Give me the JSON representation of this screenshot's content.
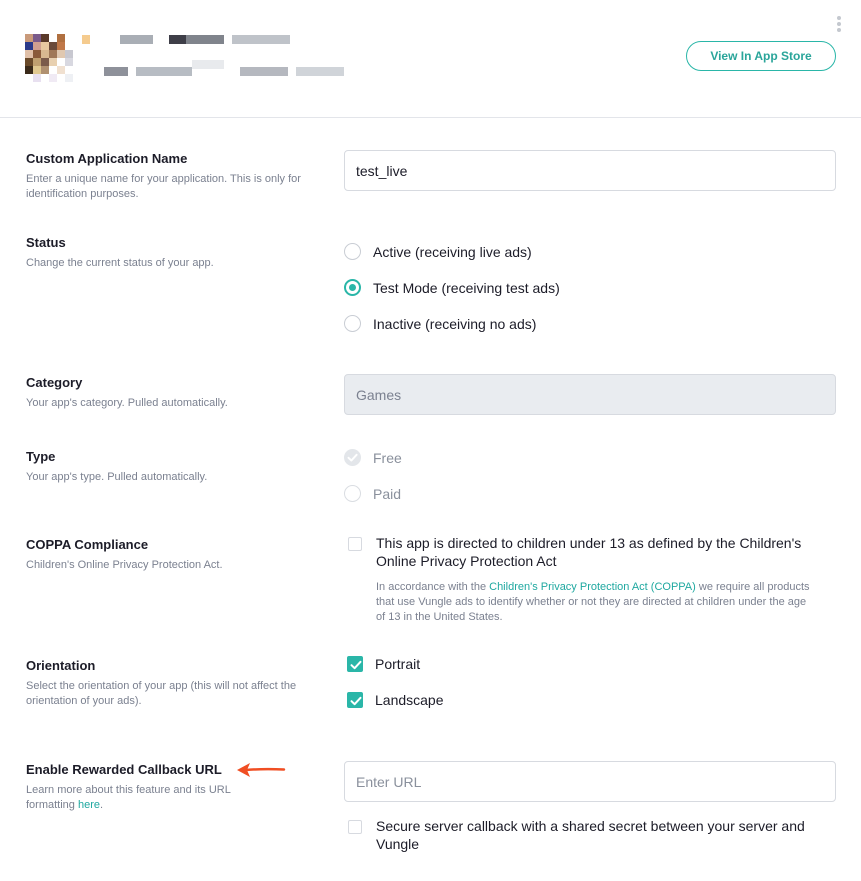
{
  "header": {
    "view_store_button": "View In App Store"
  },
  "fields": {
    "name": {
      "label": "Custom Application Name",
      "desc": "Enter a unique name for your application. This is only for identification purposes.",
      "value": "test_live"
    },
    "status": {
      "label": "Status",
      "desc": "Change the current status of your app.",
      "options": [
        "Active (receiving live ads)",
        "Test Mode (receiving test ads)",
        "Inactive (receiving no ads)"
      ],
      "selected": "Test Mode (receiving test ads)"
    },
    "category": {
      "label": "Category",
      "desc": "Your app's category. Pulled automatically.",
      "value": "Games"
    },
    "type": {
      "label": "Type",
      "desc": "Your app's type. Pulled automatically.",
      "options": [
        "Free",
        "Paid"
      ],
      "selected": "Free"
    },
    "coppa": {
      "label": "COPPA Compliance",
      "desc": "Children's Online Privacy Protection Act.",
      "checkbox_label": "This app is directed to children under 13 as defined by the Children's Online Privacy Protection Act",
      "checked": false,
      "note_prefix": "In accordance with the ",
      "note_link": "Children's Privacy Protection Act (COPPA)",
      "note_suffix": " we require all products that use Vungle ads to identify whether or not they are directed at children under the age of 13 in the United States."
    },
    "orientation": {
      "label": "Orientation",
      "desc": "Select the orientation of your app (this will not affect the orientation of your ads).",
      "options": [
        "Portrait",
        "Landscape"
      ],
      "checked": [
        true,
        true
      ]
    },
    "callback": {
      "label": "Enable Rewarded Callback URL",
      "desc_prefix": "Learn more about this feature and its URL formatting ",
      "desc_link": "here",
      "desc_suffix": ".",
      "placeholder": "Enter URL",
      "secure_label": "Secure server callback with a shared secret between your server and Vungle",
      "secure_checked": false
    }
  },
  "colors": {
    "accent": "#2ab6a8",
    "annotation_arrow": "#f04e23"
  },
  "icons": [
    "app-icon",
    "kebab-menu-icon",
    "checkmark-icon",
    "annotation-arrow-icon"
  ]
}
